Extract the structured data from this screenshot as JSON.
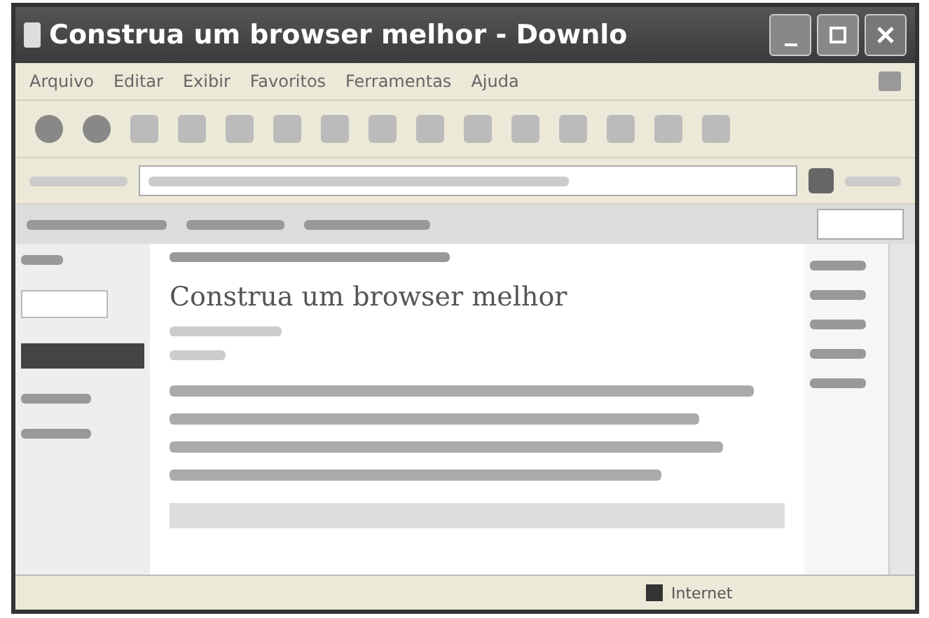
{
  "window": {
    "title": "Construa um browser melhor - Downlo"
  },
  "menu": [
    "Arquivo",
    "Editar",
    "Exibir",
    "Favoritos",
    "Ferramentas",
    "Ajuda"
  ],
  "article": {
    "title": "Construa um browser melhor"
  },
  "status_bar": {
    "zone": "Internet"
  }
}
